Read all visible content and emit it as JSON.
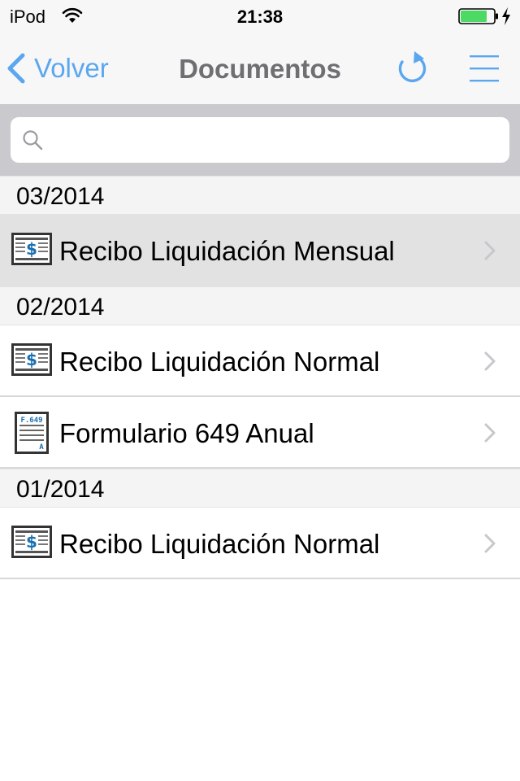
{
  "status_bar": {
    "carrier": "iPod",
    "time": "21:38",
    "wifi_icon": "wifi-icon",
    "battery_icon": "battery-icon",
    "battery_level": 0.8,
    "charging_icon": "charging-bolt-icon"
  },
  "nav": {
    "back_label": "Volver",
    "title": "Documentos",
    "refresh_icon": "refresh-icon",
    "menu_icon": "menu-icon"
  },
  "search": {
    "placeholder": "",
    "value": ""
  },
  "colors": {
    "accent": "#5aa7f0",
    "title": "#6f6f73",
    "selected_row": "#e2e2e2",
    "section_bg": "#f4f4f4"
  },
  "sections": [
    {
      "header": "03/2014",
      "items": [
        {
          "label": "Recibo Liquidación Mensual",
          "icon": "receipt-icon",
          "selected": true
        }
      ]
    },
    {
      "header": "02/2014",
      "items": [
        {
          "label": "Recibo Liquidación Normal",
          "icon": "receipt-icon",
          "selected": false
        },
        {
          "label": "Formulario 649 Anual",
          "icon": "form-icon",
          "selected": false,
          "icon_text_top": "F.649",
          "icon_text_bottom": "A"
        }
      ]
    },
    {
      "header": "01/2014",
      "items": [
        {
          "label": "Recibo Liquidación Normal",
          "icon": "receipt-icon",
          "selected": false
        }
      ]
    }
  ]
}
